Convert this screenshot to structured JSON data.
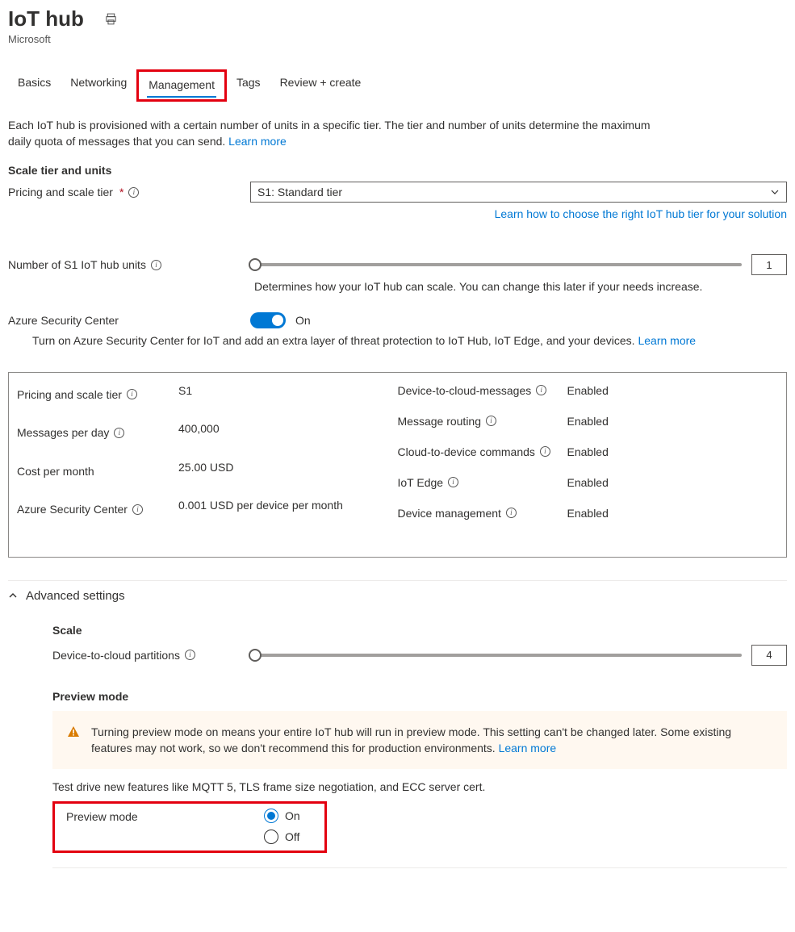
{
  "header": {
    "title": "IoT hub",
    "subtitle": "Microsoft"
  },
  "tabs": {
    "items": [
      {
        "label": "Basics"
      },
      {
        "label": "Networking"
      },
      {
        "label": "Management"
      },
      {
        "label": "Tags"
      },
      {
        "label": "Review + create"
      }
    ],
    "active": "Management"
  },
  "intro": {
    "text": "Each IoT hub is provisioned with a certain number of units in a specific tier. The tier and number of units determine the maximum daily quota of messages that you can send.",
    "learn": "Learn more"
  },
  "scale": {
    "heading": "Scale tier and units",
    "pricing_label": "Pricing and scale tier",
    "pricing_value": "S1: Standard tier",
    "choose_link": "Learn how to choose the right IoT hub tier for your solution",
    "units_label": "Number of S1 IoT hub units",
    "units_value": "1",
    "units_caption": "Determines how your IoT hub can scale. You can change this later if your needs increase."
  },
  "security": {
    "label": "Azure Security Center",
    "state": "On",
    "desc": "Turn on Azure Security Center for IoT and add an extra layer of threat protection to IoT Hub, IoT Edge, and your devices.",
    "learn": "Learn more"
  },
  "summary": {
    "left": [
      {
        "label": "Pricing and scale tier",
        "info": true,
        "value": "S1"
      },
      {
        "label": "Messages per day",
        "info": true,
        "value": "400,000"
      },
      {
        "label": "Cost per month",
        "info": false,
        "value": "25.00 USD"
      },
      {
        "label": "Azure Security Center",
        "info": true,
        "value": "0.001 USD per device per month"
      }
    ],
    "right": [
      {
        "label": "Device-to-cloud-messages",
        "info": true,
        "value": "Enabled"
      },
      {
        "label": "Message routing",
        "info": true,
        "value": "Enabled"
      },
      {
        "label": "Cloud-to-device commands",
        "info": true,
        "value": "Enabled"
      },
      {
        "label": "IoT Edge",
        "info": true,
        "value": "Enabled"
      },
      {
        "label": "Device management",
        "info": true,
        "value": "Enabled"
      }
    ]
  },
  "advanced": {
    "heading": "Advanced settings",
    "scale_heading": "Scale",
    "partitions_label": "Device-to-cloud partitions",
    "partitions_value": "4",
    "preview_heading": "Preview mode",
    "warning": "Turning preview mode on means your entire IoT hub will run in preview mode. This setting can't be changed later. Some existing features may not work, so we don't recommend this for production environments.",
    "learn": "Learn more",
    "test_text": "Test drive new features like MQTT 5, TLS frame size negotiation, and ECC server cert.",
    "radio_label": "Preview mode",
    "radio_on": "On",
    "radio_off": "Off"
  }
}
